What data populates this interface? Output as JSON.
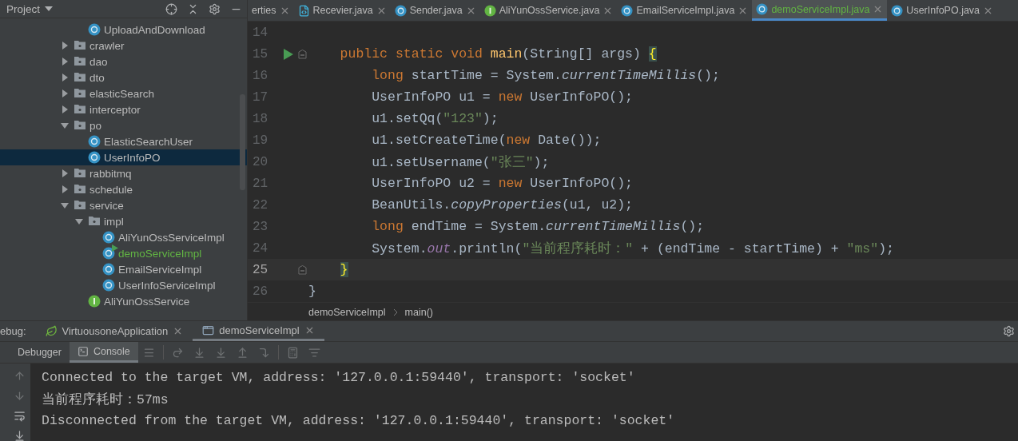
{
  "project_panel": {
    "title": "Project"
  },
  "tree": {
    "continued_items": [
      {
        "kind": "class",
        "label": "UploadAndDownload",
        "selected": false,
        "added": false,
        "runnable": false
      }
    ],
    "items": [
      {
        "kind": "folder",
        "label": "crawler",
        "expanded": false,
        "selected": false,
        "added": false
      },
      {
        "kind": "folder",
        "label": "dao",
        "expanded": false,
        "selected": false,
        "added": false
      },
      {
        "kind": "folder",
        "label": "dto",
        "expanded": false,
        "selected": false,
        "added": false
      },
      {
        "kind": "folder",
        "label": "elasticSearch",
        "expanded": false,
        "selected": false,
        "added": false
      },
      {
        "kind": "folder",
        "label": "interceptor",
        "expanded": false,
        "selected": false,
        "added": false
      },
      {
        "kind": "folder",
        "label": "po",
        "expanded": true,
        "selected": false,
        "added": false,
        "children": [
          {
            "kind": "class",
            "label": "ElasticSearchUser",
            "selected": false,
            "added": false,
            "runnable": false
          },
          {
            "kind": "class",
            "label": "UserInfoPO",
            "selected": true,
            "added": false,
            "runnable": false
          }
        ]
      },
      {
        "kind": "folder",
        "label": "rabbitmq",
        "expanded": false,
        "selected": false,
        "added": false
      },
      {
        "kind": "folder",
        "label": "schedule",
        "expanded": false,
        "selected": false,
        "added": false
      },
      {
        "kind": "folder",
        "label": "service",
        "expanded": true,
        "selected": false,
        "added": false,
        "children": [
          {
            "kind": "folder",
            "label": "impl",
            "expanded": true,
            "selected": false,
            "added": false,
            "children": [
              {
                "kind": "class",
                "label": "AliYunOssServiceImpl",
                "selected": false,
                "added": false,
                "runnable": false
              },
              {
                "kind": "class",
                "label": "demoServiceImpl",
                "selected": false,
                "added": true,
                "runnable": true
              },
              {
                "kind": "class",
                "label": "EmailServiceImpl",
                "selected": false,
                "added": false,
                "runnable": false
              },
              {
                "kind": "class",
                "label": "UserInfoServiceImpl",
                "selected": false,
                "added": false,
                "runnable": false
              }
            ]
          },
          {
            "kind": "interface",
            "label": "AliYunOssService",
            "selected": false,
            "added": false,
            "runnable": false
          }
        ]
      }
    ]
  },
  "editor_tabs": [
    {
      "kind": "properties",
      "label": "erties",
      "selected": false,
      "added": false
    },
    {
      "kind": "file",
      "label": "Recevier.java",
      "selected": false,
      "added": false
    },
    {
      "kind": "class",
      "label": "Sender.java",
      "selected": false,
      "added": false
    },
    {
      "kind": "interface",
      "label": "AliYunOssService.java",
      "selected": false,
      "added": false
    },
    {
      "kind": "class",
      "label": "EmailServiceImpl.java",
      "selected": false,
      "added": false
    },
    {
      "kind": "class",
      "label": "demoServiceImpl.java",
      "selected": true,
      "added": true
    },
    {
      "kind": "class",
      "label": "UserInfoPO.java",
      "selected": false,
      "added": false
    }
  ],
  "editor": {
    "lines": [
      {
        "number": "14",
        "current": false,
        "run_marker": false,
        "fold_marker": false
      },
      {
        "number": "15",
        "current": false,
        "run_marker": true,
        "fold_marker": true,
        "tokens": [
          {
            "kind": "keyword",
            "text": "    public static void "
          },
          {
            "kind": "method",
            "text": "main"
          },
          {
            "kind": "plain",
            "text": "(String[] args) "
          },
          {
            "kind": "brace_match",
            "text": "{"
          }
        ]
      },
      {
        "number": "16",
        "current": false,
        "run_marker": false,
        "fold_marker": false,
        "tokens": [
          {
            "kind": "keyword",
            "text": "        long"
          },
          {
            "kind": "plain",
            "text": " startTime = System."
          },
          {
            "kind": "static_call",
            "text": "currentTimeMillis"
          },
          {
            "kind": "plain",
            "text": "();"
          }
        ]
      },
      {
        "number": "17",
        "current": false,
        "run_marker": false,
        "fold_marker": false,
        "tokens": [
          {
            "kind": "plain",
            "text": "        UserInfoPO u1 = "
          },
          {
            "kind": "keyword",
            "text": "new"
          },
          {
            "kind": "plain",
            "text": " UserInfoPO();"
          }
        ]
      },
      {
        "number": "18",
        "current": false,
        "run_marker": false,
        "fold_marker": false,
        "tokens": [
          {
            "kind": "plain",
            "text": "        u1.setQq("
          },
          {
            "kind": "string",
            "text": "\"123\""
          },
          {
            "kind": "plain",
            "text": ");"
          }
        ]
      },
      {
        "number": "19",
        "current": false,
        "run_marker": false,
        "fold_marker": false,
        "tokens": [
          {
            "kind": "plain",
            "text": "        u1.setCreateTime("
          },
          {
            "kind": "keyword",
            "text": "new"
          },
          {
            "kind": "plain",
            "text": " Date());"
          }
        ]
      },
      {
        "number": "20",
        "current": false,
        "run_marker": false,
        "fold_marker": false,
        "tokens": [
          {
            "kind": "plain",
            "text": "        u1.setUsername("
          },
          {
            "kind": "string",
            "text": "\"张三\""
          },
          {
            "kind": "plain",
            "text": ");"
          }
        ]
      },
      {
        "number": "21",
        "current": false,
        "run_marker": false,
        "fold_marker": false,
        "tokens": [
          {
            "kind": "plain",
            "text": "        UserInfoPO u2 = "
          },
          {
            "kind": "keyword",
            "text": "new"
          },
          {
            "kind": "plain",
            "text": " UserInfoPO();"
          }
        ]
      },
      {
        "number": "22",
        "current": false,
        "run_marker": false,
        "fold_marker": false,
        "tokens": [
          {
            "kind": "plain",
            "text": "        BeanUtils."
          },
          {
            "kind": "static_call",
            "text": "copyProperties"
          },
          {
            "kind": "plain",
            "text": "(u1, u2);"
          }
        ]
      },
      {
        "number": "23",
        "current": false,
        "run_marker": false,
        "fold_marker": false,
        "tokens": [
          {
            "kind": "keyword",
            "text": "        long"
          },
          {
            "kind": "plain",
            "text": " endTime = System."
          },
          {
            "kind": "static_call",
            "text": "currentTimeMillis"
          },
          {
            "kind": "plain",
            "text": "();"
          }
        ]
      },
      {
        "number": "24",
        "current": false,
        "run_marker": false,
        "fold_marker": false,
        "tokens": [
          {
            "kind": "plain",
            "text": "        System."
          },
          {
            "kind": "field",
            "text": "out"
          },
          {
            "kind": "plain",
            "text": ".println("
          },
          {
            "kind": "string",
            "text": "\"当前程序耗时：\""
          },
          {
            "kind": "plain",
            "text": " + (endTime - startTime) + "
          },
          {
            "kind": "string",
            "text": "\"ms\""
          },
          {
            "kind": "plain",
            "text": ");"
          }
        ]
      },
      {
        "number": "25",
        "current": true,
        "run_marker": false,
        "fold_marker": true,
        "tokens": [
          {
            "kind": "brace_match",
            "text": "    }"
          }
        ]
      },
      {
        "number": "26",
        "current": false,
        "run_marker": false,
        "fold_marker": false,
        "tokens": [
          {
            "kind": "plain",
            "text": "}"
          }
        ]
      }
    ]
  },
  "breadcrumbs": [
    "demoServiceImpl",
    "main()"
  ],
  "debug": {
    "label": "ebug:",
    "tabs": [
      {
        "kind": "spring",
        "label": "VirtuousoneApplication",
        "selected": false
      },
      {
        "kind": "window",
        "label": "demoServiceImpl",
        "selected": true
      }
    ],
    "sub_tabs": [
      {
        "kind": "plain",
        "label": "Debugger",
        "selected": false
      },
      {
        "kind": "console",
        "label": "Console",
        "selected": true
      }
    ],
    "console_lines": [
      "Connected to the target VM, address: '127.0.0.1:59440', transport: 'socket'",
      "当前程序耗时：57ms",
      "Disconnected from the target VM, address: '127.0.0.1:59440', transport: 'socket'"
    ]
  }
}
